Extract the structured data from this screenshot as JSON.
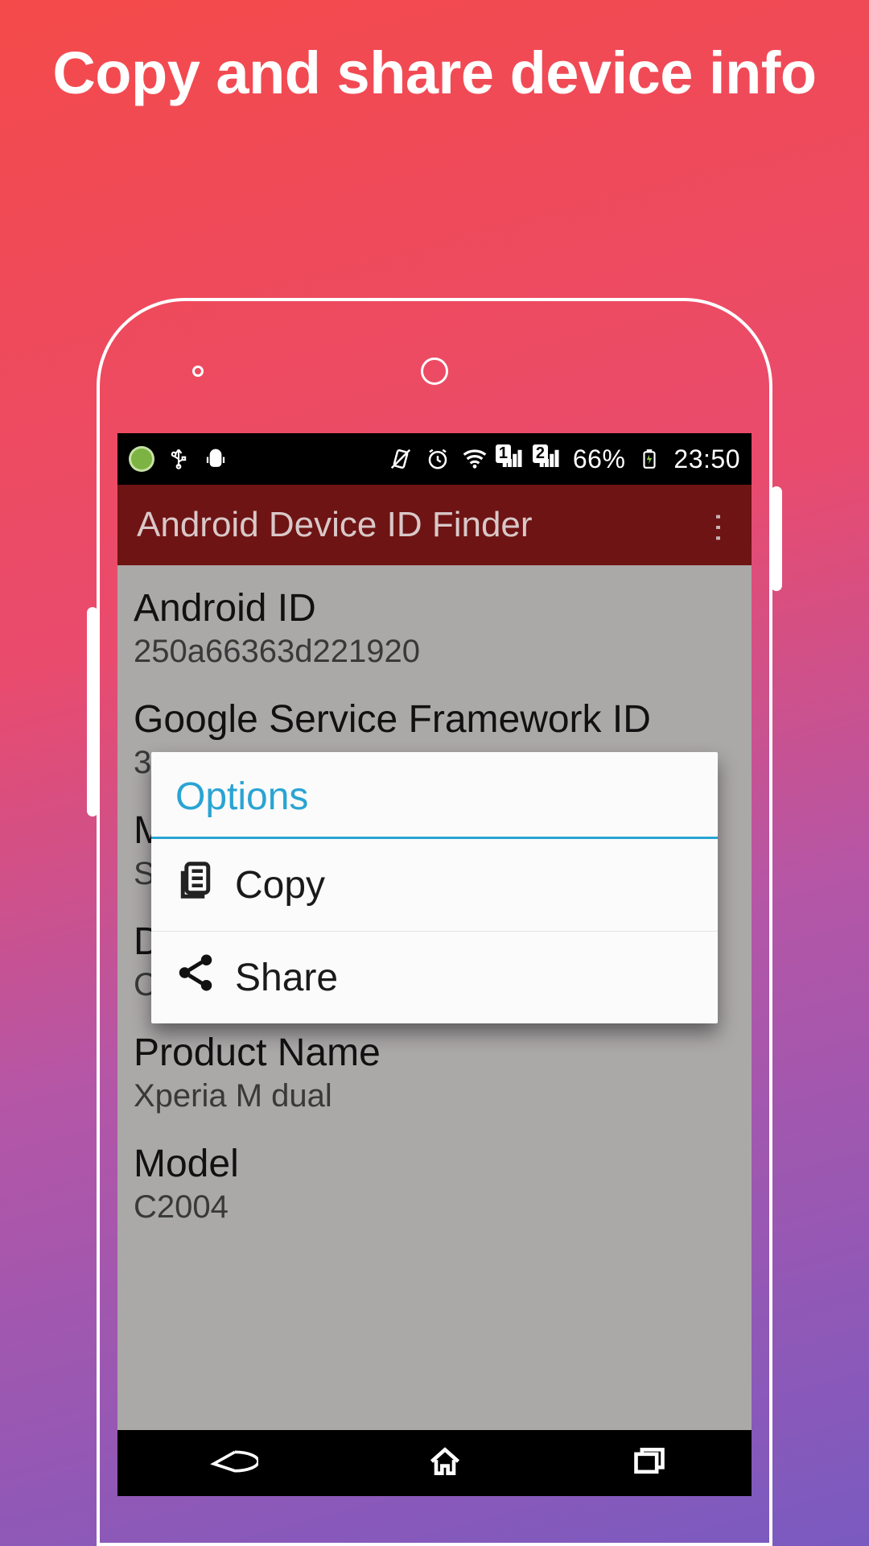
{
  "promo": {
    "title": "Copy and share device info"
  },
  "status": {
    "battery": "66%",
    "clock": "23:50",
    "sim1": "1",
    "sim2": "2"
  },
  "app": {
    "title": "Android Device ID Finder"
  },
  "items": {
    "android_id": {
      "label": "Android ID",
      "value": "250a66363d221920"
    },
    "gsf_id": {
      "label": "Google Service Framework ID",
      "value": "3"
    },
    "m_row": {
      "label": "M",
      "value": "S"
    },
    "d_row": {
      "label": "D",
      "value": "C"
    },
    "product": {
      "label": "Product Name",
      "value": "Xperia M dual"
    },
    "model": {
      "label": "Model",
      "value": "C2004"
    }
  },
  "dialog": {
    "title": "Options",
    "copy": "Copy",
    "share": "Share"
  }
}
